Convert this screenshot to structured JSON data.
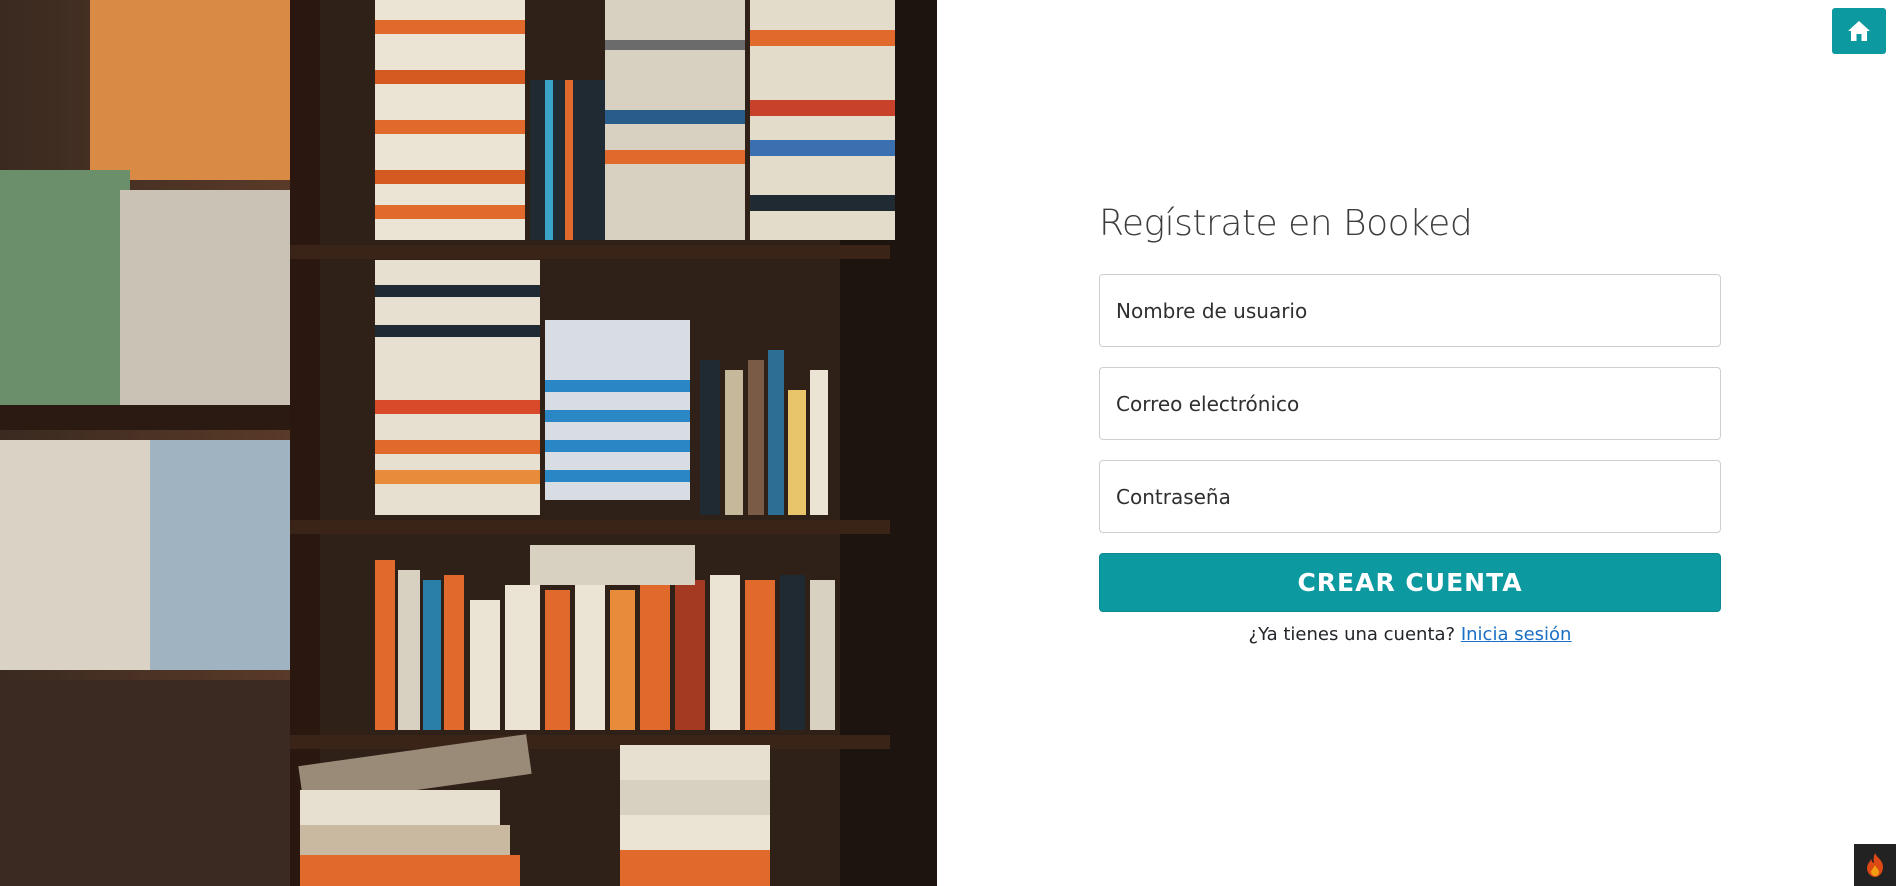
{
  "header": {
    "home_icon": "home-icon"
  },
  "form": {
    "title": "Regístrate en Booked",
    "username_placeholder": "Nombre de usuario",
    "email_placeholder": "Correo electrónico",
    "password_placeholder": "Contraseña",
    "submit_label": "CREAR CUENTA",
    "login_prompt": "¿Ya tienes una cuenta?",
    "login_link": "Inicia sesión"
  },
  "footer": {
    "badge_icon": "flame-icon"
  },
  "colors": {
    "accent": "#0c9aa0",
    "link": "#1a6fc4"
  }
}
